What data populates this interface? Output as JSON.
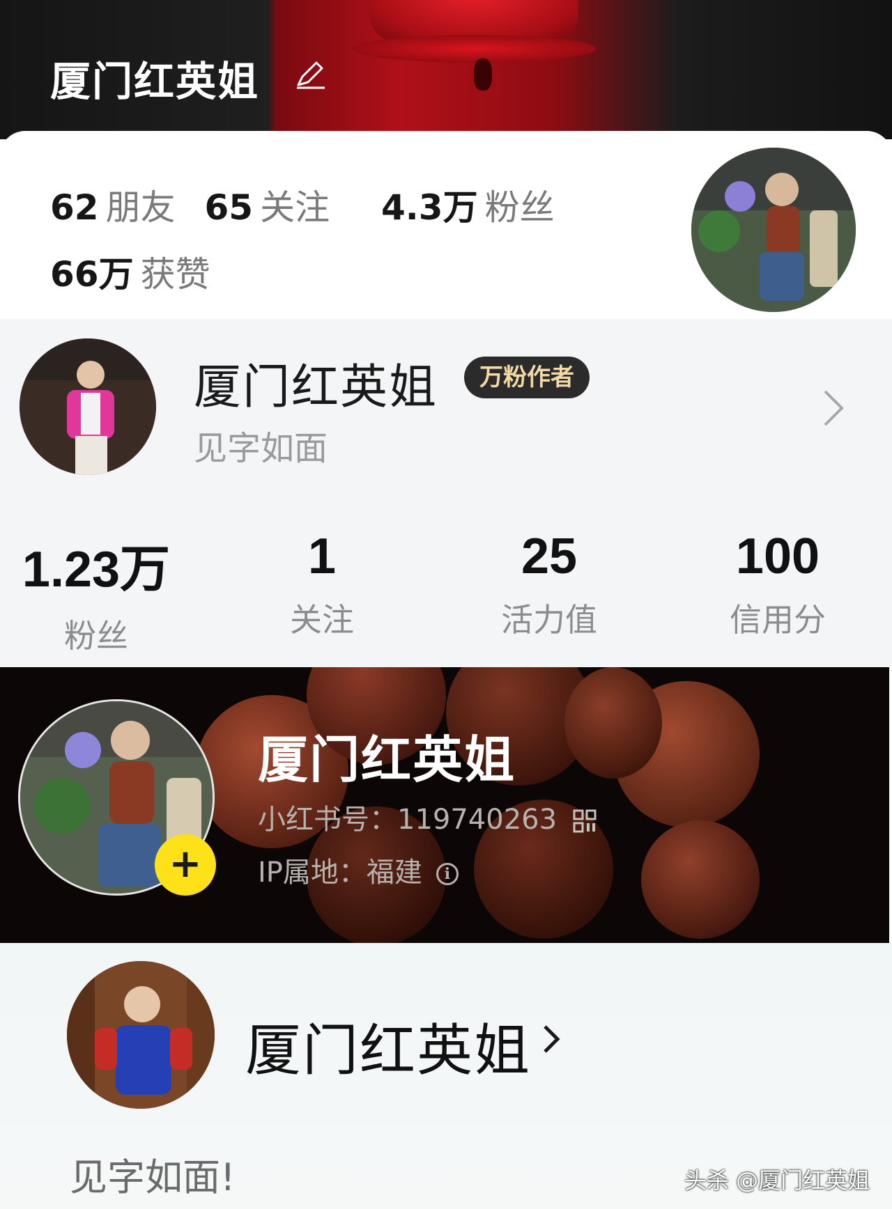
{
  "douyin": {
    "title": "厦门红英姐",
    "stats_row1": [
      {
        "value": "62",
        "label": "朋友"
      },
      {
        "value": "65",
        "label": "关注"
      },
      {
        "value": "4.3万",
        "label": "粉丝"
      }
    ],
    "stats_row2": [
      {
        "value": "66万",
        "label": "获赞"
      }
    ]
  },
  "toutiao": {
    "name": "厦门红英姐",
    "badge": "万粉作者",
    "subtitle": "见字如面",
    "stats": [
      {
        "value": "1.23万",
        "label": "粉丝"
      },
      {
        "value": "1",
        "label": "关注"
      },
      {
        "value": "25",
        "label": "活力值"
      },
      {
        "value": "100",
        "label": "信用分"
      }
    ]
  },
  "xiaohongshu": {
    "name": "厦门红英姐",
    "id_text": "小红书号：119740263",
    "ip_text": "IP属地：福建",
    "follow_symbol": "+"
  },
  "weibo": {
    "name": "厦门红英姐",
    "bio": "见字如面!"
  },
  "watermark": "头杀 @厦门红英姐",
  "colors": {
    "banner_red": "#b01018",
    "follow_yellow": "#ffe11a",
    "badge_bg": "#2b2b2b",
    "badge_text": "#f3d9a6"
  }
}
